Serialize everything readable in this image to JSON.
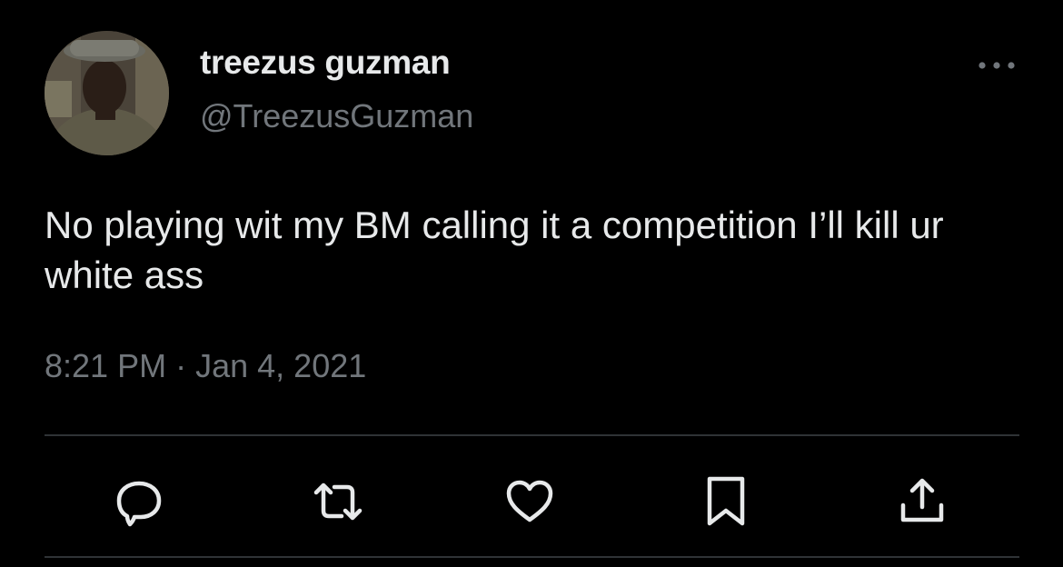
{
  "tweet": {
    "display_name": "treezus guzman",
    "handle": "@TreezusGuzman",
    "text": "No playing wit my BM calling it a competition I’ll kill ur white ass",
    "time": "8:21 PM",
    "separator": "·",
    "date": "Jan 4, 2021"
  },
  "icons": {
    "more": "more-horizontal-icon",
    "reply": "reply-icon",
    "retweet": "retweet-icon",
    "like": "heart-icon",
    "bookmark": "bookmark-icon",
    "share": "share-icon"
  },
  "colors": {
    "background": "#000000",
    "primary_text": "#e7e9ea",
    "secondary_text": "#71767b",
    "divider": "#2f3336"
  }
}
